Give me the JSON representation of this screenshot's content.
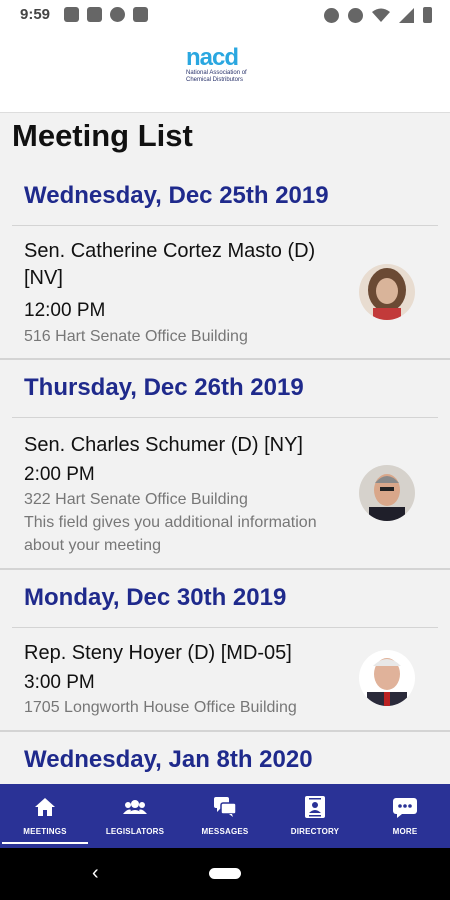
{
  "status_bar": {
    "time": "9:59",
    "left_icons": [
      "gallery-icon",
      "font-icon",
      "a-icon",
      "image-icon"
    ],
    "right_icons": [
      "alarm-icon",
      "hotspot-icon",
      "wifi-icon",
      "signal-icon",
      "battery-icon"
    ]
  },
  "header": {
    "logo_text": "nacd",
    "logo_subtitle_line1": "National Association of",
    "logo_subtitle_line2": "Chemical Distributors"
  },
  "page": {
    "title": "Meeting List"
  },
  "days": [
    {
      "label": "Wednesday, Dec 25th 2019",
      "meetings": [
        {
          "name": "Sen. Catherine Cortez Masto (D) [NV]",
          "time": "12:00 PM",
          "location": "516 Hart Senate Office Building",
          "notes": ""
        }
      ]
    },
    {
      "label": "Thursday, Dec 26th 2019",
      "meetings": [
        {
          "name": "Sen. Charles Schumer (D) [NY]",
          "time": "2:00 PM",
          "location": "322 Hart Senate Office Building",
          "notes": "This field gives you additional information about your meeting"
        }
      ]
    },
    {
      "label": "Monday, Dec 30th 2019",
      "meetings": [
        {
          "name": "Rep. Steny Hoyer (D) [MD-05]",
          "time": "3:00 PM",
          "location": "1705 Longworth House Office Building",
          "notes": ""
        }
      ]
    },
    {
      "label": "Wednesday, Jan 8th 2020",
      "meetings": []
    }
  ],
  "bottom_nav": [
    {
      "label": "MEETINGS",
      "icon": "home-icon",
      "active": true
    },
    {
      "label": "LEGISLATORS",
      "icon": "people-icon",
      "active": false
    },
    {
      "label": "MESSAGES",
      "icon": "chat-icon",
      "active": false
    },
    {
      "label": "DIRECTORY",
      "icon": "contact-card-icon",
      "active": false
    },
    {
      "label": "MORE",
      "icon": "more-icon",
      "active": false
    }
  ],
  "colors": {
    "accent": "#1f2a8c",
    "nav_bg": "#2a3296",
    "location_text": "#777777"
  }
}
